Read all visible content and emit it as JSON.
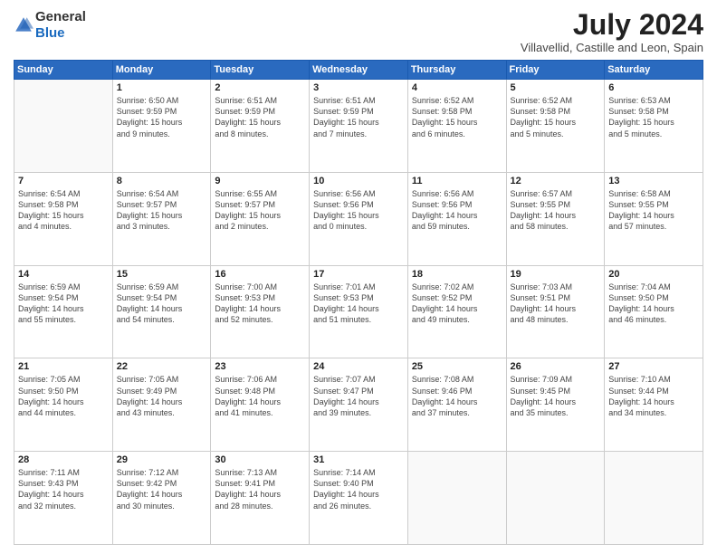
{
  "header": {
    "logo_general": "General",
    "logo_blue": "Blue",
    "month": "July 2024",
    "location": "Villavellid, Castille and Leon, Spain"
  },
  "days_of_week": [
    "Sunday",
    "Monday",
    "Tuesday",
    "Wednesday",
    "Thursday",
    "Friday",
    "Saturday"
  ],
  "weeks": [
    [
      {
        "day": "",
        "info": ""
      },
      {
        "day": "1",
        "info": "Sunrise: 6:50 AM\nSunset: 9:59 PM\nDaylight: 15 hours\nand 9 minutes."
      },
      {
        "day": "2",
        "info": "Sunrise: 6:51 AM\nSunset: 9:59 PM\nDaylight: 15 hours\nand 8 minutes."
      },
      {
        "day": "3",
        "info": "Sunrise: 6:51 AM\nSunset: 9:59 PM\nDaylight: 15 hours\nand 7 minutes."
      },
      {
        "day": "4",
        "info": "Sunrise: 6:52 AM\nSunset: 9:58 PM\nDaylight: 15 hours\nand 6 minutes."
      },
      {
        "day": "5",
        "info": "Sunrise: 6:52 AM\nSunset: 9:58 PM\nDaylight: 15 hours\nand 5 minutes."
      },
      {
        "day": "6",
        "info": "Sunrise: 6:53 AM\nSunset: 9:58 PM\nDaylight: 15 hours\nand 5 minutes."
      }
    ],
    [
      {
        "day": "7",
        "info": "Sunrise: 6:54 AM\nSunset: 9:58 PM\nDaylight: 15 hours\nand 4 minutes."
      },
      {
        "day": "8",
        "info": "Sunrise: 6:54 AM\nSunset: 9:57 PM\nDaylight: 15 hours\nand 3 minutes."
      },
      {
        "day": "9",
        "info": "Sunrise: 6:55 AM\nSunset: 9:57 PM\nDaylight: 15 hours\nand 2 minutes."
      },
      {
        "day": "10",
        "info": "Sunrise: 6:56 AM\nSunset: 9:56 PM\nDaylight: 15 hours\nand 0 minutes."
      },
      {
        "day": "11",
        "info": "Sunrise: 6:56 AM\nSunset: 9:56 PM\nDaylight: 14 hours\nand 59 minutes."
      },
      {
        "day": "12",
        "info": "Sunrise: 6:57 AM\nSunset: 9:55 PM\nDaylight: 14 hours\nand 58 minutes."
      },
      {
        "day": "13",
        "info": "Sunrise: 6:58 AM\nSunset: 9:55 PM\nDaylight: 14 hours\nand 57 minutes."
      }
    ],
    [
      {
        "day": "14",
        "info": "Sunrise: 6:59 AM\nSunset: 9:54 PM\nDaylight: 14 hours\nand 55 minutes."
      },
      {
        "day": "15",
        "info": "Sunrise: 6:59 AM\nSunset: 9:54 PM\nDaylight: 14 hours\nand 54 minutes."
      },
      {
        "day": "16",
        "info": "Sunrise: 7:00 AM\nSunset: 9:53 PM\nDaylight: 14 hours\nand 52 minutes."
      },
      {
        "day": "17",
        "info": "Sunrise: 7:01 AM\nSunset: 9:53 PM\nDaylight: 14 hours\nand 51 minutes."
      },
      {
        "day": "18",
        "info": "Sunrise: 7:02 AM\nSunset: 9:52 PM\nDaylight: 14 hours\nand 49 minutes."
      },
      {
        "day": "19",
        "info": "Sunrise: 7:03 AM\nSunset: 9:51 PM\nDaylight: 14 hours\nand 48 minutes."
      },
      {
        "day": "20",
        "info": "Sunrise: 7:04 AM\nSunset: 9:50 PM\nDaylight: 14 hours\nand 46 minutes."
      }
    ],
    [
      {
        "day": "21",
        "info": "Sunrise: 7:05 AM\nSunset: 9:50 PM\nDaylight: 14 hours\nand 44 minutes."
      },
      {
        "day": "22",
        "info": "Sunrise: 7:05 AM\nSunset: 9:49 PM\nDaylight: 14 hours\nand 43 minutes."
      },
      {
        "day": "23",
        "info": "Sunrise: 7:06 AM\nSunset: 9:48 PM\nDaylight: 14 hours\nand 41 minutes."
      },
      {
        "day": "24",
        "info": "Sunrise: 7:07 AM\nSunset: 9:47 PM\nDaylight: 14 hours\nand 39 minutes."
      },
      {
        "day": "25",
        "info": "Sunrise: 7:08 AM\nSunset: 9:46 PM\nDaylight: 14 hours\nand 37 minutes."
      },
      {
        "day": "26",
        "info": "Sunrise: 7:09 AM\nSunset: 9:45 PM\nDaylight: 14 hours\nand 35 minutes."
      },
      {
        "day": "27",
        "info": "Sunrise: 7:10 AM\nSunset: 9:44 PM\nDaylight: 14 hours\nand 34 minutes."
      }
    ],
    [
      {
        "day": "28",
        "info": "Sunrise: 7:11 AM\nSunset: 9:43 PM\nDaylight: 14 hours\nand 32 minutes."
      },
      {
        "day": "29",
        "info": "Sunrise: 7:12 AM\nSunset: 9:42 PM\nDaylight: 14 hours\nand 30 minutes."
      },
      {
        "day": "30",
        "info": "Sunrise: 7:13 AM\nSunset: 9:41 PM\nDaylight: 14 hours\nand 28 minutes."
      },
      {
        "day": "31",
        "info": "Sunrise: 7:14 AM\nSunset: 9:40 PM\nDaylight: 14 hours\nand 26 minutes."
      },
      {
        "day": "",
        "info": ""
      },
      {
        "day": "",
        "info": ""
      },
      {
        "day": "",
        "info": ""
      }
    ]
  ]
}
